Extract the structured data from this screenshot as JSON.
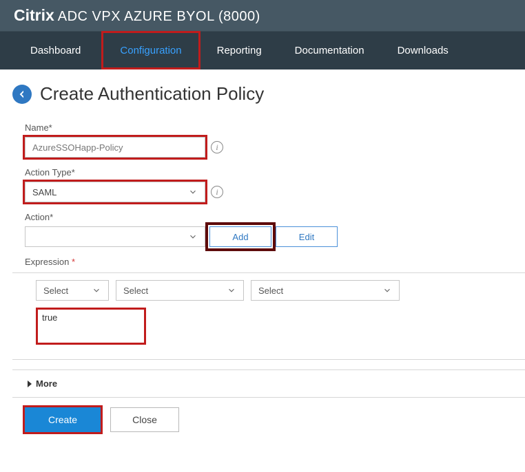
{
  "brand": {
    "strong": "Citrix",
    "rest": " ADC VPX AZURE BYOL (8000)"
  },
  "nav": {
    "items": [
      "Dashboard",
      "Configuration",
      "Reporting",
      "Documentation",
      "Downloads"
    ],
    "active_index": 1
  },
  "page": {
    "title": "Create Authentication Policy",
    "fields": {
      "name_label": "Name*",
      "name_value": "AzureSSOHapp-Policy",
      "action_type_label": "Action Type*",
      "action_type_value": "SAML",
      "action_label": "Action*",
      "action_value": "",
      "add_btn": "Add",
      "edit_btn": "Edit",
      "expression_label": "Expression",
      "expr_select_placeholder": "Select",
      "expr_text": "true",
      "more_label": "More"
    },
    "buttons": {
      "create": "Create",
      "close": "Close"
    }
  }
}
